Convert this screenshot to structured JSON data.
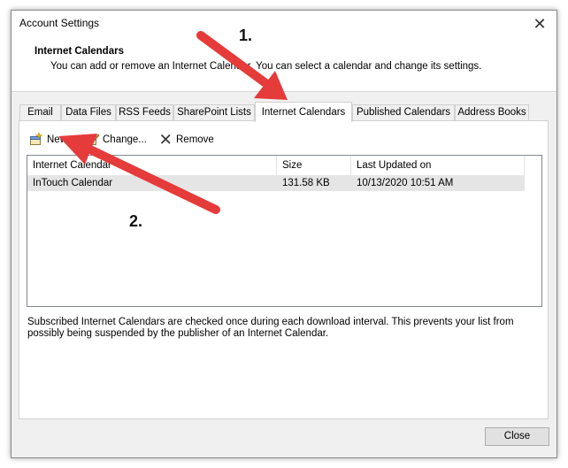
{
  "window": {
    "title": "Account Settings",
    "close_glyph": "✕"
  },
  "header": {
    "title": "Internet Calendars",
    "description": "You can add or remove an Internet Calendar. You can select a calendar and change its settings."
  },
  "tabs": [
    {
      "label": "Email",
      "active": false
    },
    {
      "label": "Data Files",
      "active": false
    },
    {
      "label": "RSS Feeds",
      "active": false
    },
    {
      "label": "SharePoint Lists",
      "active": false
    },
    {
      "label": "Internet Calendars",
      "active": true
    },
    {
      "label": "Published Calendars",
      "active": false
    },
    {
      "label": "Address Books",
      "active": false
    }
  ],
  "toolbar": {
    "new_label": "New...",
    "change_label": "Change...",
    "remove_label": "Remove"
  },
  "table": {
    "columns": [
      "Internet Calendar",
      "Size",
      "Last Updated on"
    ],
    "rows": [
      {
        "name": "InTouch Calendar",
        "size": "131.58 KB",
        "updated": "10/13/2020 10:51 AM"
      }
    ]
  },
  "note": "Subscribed Internet Calendars are checked once during each download interval. This prevents your list from possibly being suspended by the publisher of an Internet Calendar.",
  "buttons": {
    "close_label": "Close"
  },
  "annotations": {
    "step1": "1.",
    "step2": "2.",
    "arrow_color": "#e53b3b"
  },
  "icons": {
    "new": "new-calendar-icon",
    "change": "change-icon",
    "remove": "remove-x-icon",
    "window_close": "close-icon"
  }
}
